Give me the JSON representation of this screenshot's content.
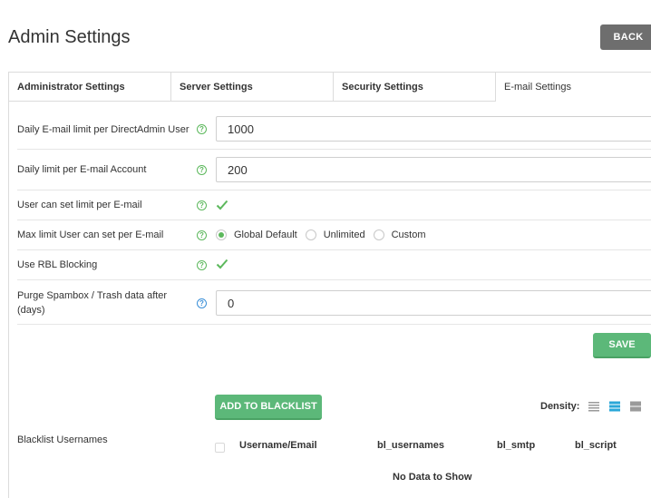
{
  "page": {
    "title": "Admin Settings",
    "back_label": "BACK"
  },
  "tabs": [
    {
      "label": "Administrator Settings"
    },
    {
      "label": "Server Settings"
    },
    {
      "label": "Security Settings"
    },
    {
      "label": "E-mail Settings"
    }
  ],
  "active_tab": "E-mail Settings",
  "settings": {
    "daily_limit_user": {
      "label": "Daily E-mail limit per DirectAdmin User",
      "value": "1000"
    },
    "daily_limit_account": {
      "label": "Daily limit per E-mail Account",
      "value": "200"
    },
    "user_set_limit": {
      "label": "User can set limit per E-mail",
      "checked": true
    },
    "max_limit": {
      "label": "Max limit User can set per E-mail",
      "options": [
        "Global Default",
        "Unlimited",
        "Custom"
      ],
      "selected": "Global Default"
    },
    "rbl": {
      "label": "Use RBL Blocking",
      "checked": true
    },
    "purge": {
      "label_line1": "Purge Spambox / Trash data after",
      "label_line2": "(days)",
      "value": "0"
    },
    "help_glyph": "?"
  },
  "save_label": "SAVE",
  "blacklist": {
    "section_label": "Blacklist Usernames",
    "add_label": "ADD TO BLACKLIST",
    "density_label": "Density:",
    "columns": [
      "Username/Email",
      "bl_usernames",
      "bl_smtp",
      "bl_script"
    ],
    "empty_text": "No Data to Show"
  },
  "colors": {
    "accent_green": "#5cb879",
    "help_green": "#5cb85c",
    "help_blue": "#3a8fd8",
    "density_active": "#2aa7d8",
    "back_gray": "#6e6e6e"
  }
}
